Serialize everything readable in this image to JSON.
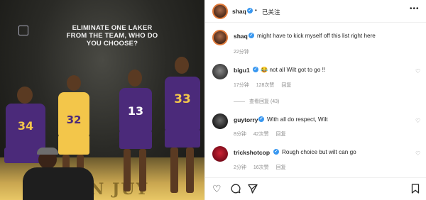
{
  "post": {
    "image": {
      "headline": "ELIMINATE ONE LAKER FROM THE TEAM, WHO DO YOU CHOOSE?",
      "players": [
        {
          "number": "34"
        },
        {
          "number": "32"
        },
        {
          "number": "13"
        },
        {
          "number": "33"
        }
      ],
      "floor_text": "OMN  JUY"
    },
    "header": {
      "username": "shaq",
      "follow_label": "已关注"
    },
    "caption": {
      "username": "shaq",
      "text": "might have to kick myself off this list right here",
      "time": "22分钟"
    },
    "comments": [
      {
        "username": "bigu1",
        "text": "😂 not all Wilt got to go !!",
        "time": "17分钟",
        "likes": "128次赞",
        "reply_label": "回复",
        "view_replies": "查看回复 (43)"
      },
      {
        "username": "guytorry",
        "text": "With all do respect, Wilt",
        "time": "8分钟",
        "likes": "42次赞",
        "reply_label": "回复"
      },
      {
        "username": "trickshotcop",
        "text": "Rough choice but wilt can go",
        "time": "2分钟",
        "likes": "16次赞",
        "reply_label": "回复"
      }
    ],
    "icons": {
      "verified": "verified-badge-icon",
      "like": "heart-icon",
      "comment": "comment-icon",
      "share": "send-icon",
      "save": "bookmark-icon",
      "more": "more-icon"
    },
    "colors": {
      "verified": "#3897f0",
      "lakers_purple": "#4b2a7a",
      "lakers_gold": "#f3c64a"
    }
  }
}
